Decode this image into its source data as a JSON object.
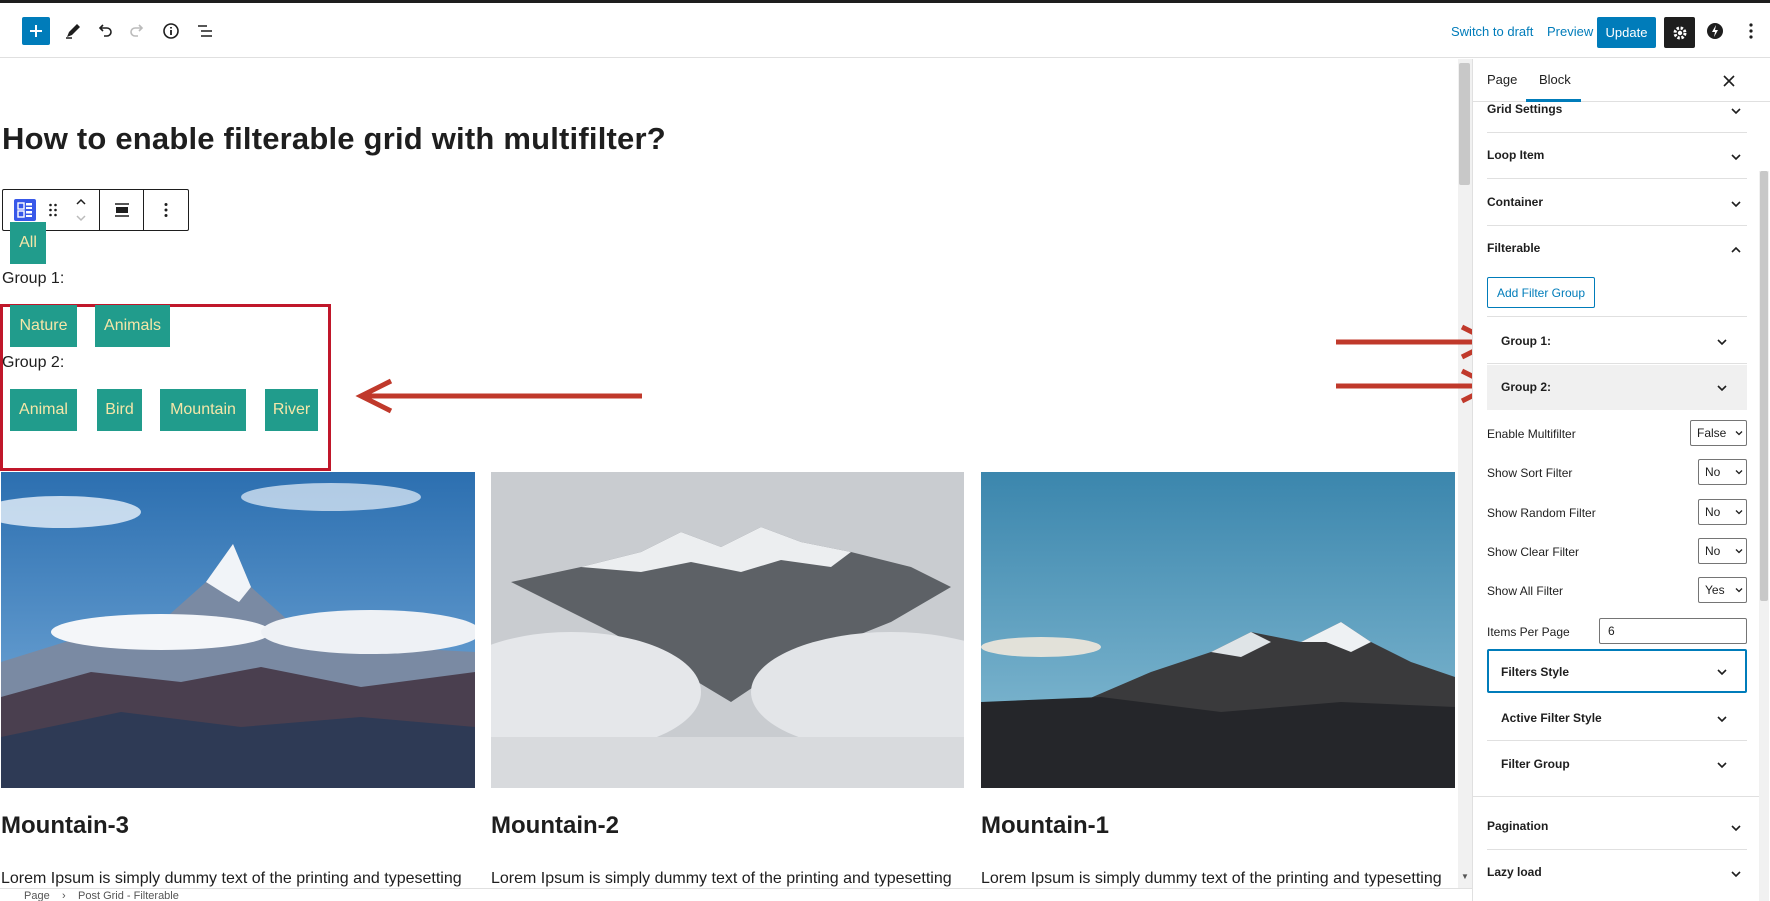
{
  "topbar": {
    "switch_to_draft": "Switch to draft",
    "preview": "Preview",
    "update": "Update",
    "icons": [
      "plus-icon",
      "pencil-icon",
      "undo-icon",
      "redo-icon",
      "info-icon",
      "list-view-icon",
      "gear-icon",
      "plugin-icon",
      "more-vertical-icon"
    ]
  },
  "canvas": {
    "page_title": "How to enable filterable grid with multifilter?",
    "filters": {
      "all": "All",
      "group1_label": "Group 1:",
      "group1": [
        "Nature",
        "Animals"
      ],
      "group2_label": "Group 2:",
      "group2": [
        "Animal",
        "Bird",
        "Mountain",
        "River"
      ]
    },
    "cards": [
      {
        "title": "Mountain-3",
        "text": "Lorem Ipsum is simply dummy text of the printing and typesetting"
      },
      {
        "title": "Mountain-2",
        "text": "Lorem Ipsum is simply dummy text of the printing and typesetting"
      },
      {
        "title": "Mountain-1",
        "text": "Lorem Ipsum is simply dummy text of the printing and typesetting"
      }
    ],
    "colors": {
      "filter_bg": "#219c8c",
      "filter_text": "#f5e6a8",
      "annotation_red": "#c0172a",
      "arrow": "#c0392b"
    }
  },
  "breadcrumb": {
    "items": [
      "Page",
      "Post Grid - Filterable"
    ]
  },
  "sidebar": {
    "tabs": [
      "Page",
      "Block"
    ],
    "panels": {
      "grid_settings": "Grid Settings",
      "loop_item": "Loop Item",
      "container": "Container",
      "filterable": "Filterable",
      "pagination": "Pagination",
      "lazy_load": "Lazy load"
    },
    "add_filter_group": "Add Filter Group",
    "group1": "Group 1:",
    "group2": "Group 2:",
    "fields": {
      "enable_multifilter": {
        "label": "Enable Multifilter",
        "value": "False"
      },
      "show_sort_filter": {
        "label": "Show Sort Filter",
        "value": "No"
      },
      "show_random_filter": {
        "label": "Show Random Filter",
        "value": "No"
      },
      "show_clear_filter": {
        "label": "Show Clear Filter",
        "value": "No"
      },
      "show_all_filter": {
        "label": "Show All Filter",
        "value": "Yes"
      },
      "items_per_page": {
        "label": "Items Per Page",
        "value": "6"
      }
    },
    "subpanels": {
      "filters_style": "Filters Style",
      "active_filter_style": "Active Filter Style",
      "filter_group": "Filter Group"
    }
  }
}
